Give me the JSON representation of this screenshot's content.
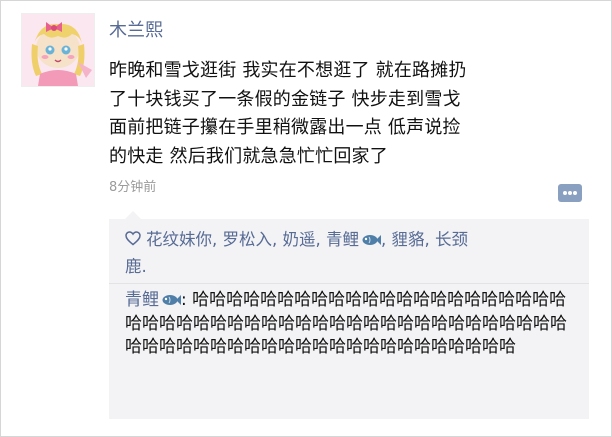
{
  "post": {
    "username": "木兰熙",
    "avatar_icon": "anime-girl-avatar",
    "lines": [
      "昨晚和雪戈逛街 我实在不想逛了 就在路摊扔",
      "了十块钱买了一条假的金链子 快步走到雪戈",
      "面前把链子攥在手里稍微露出一点 低声说捡",
      "的快走 然后我们就急急忙忙回家了"
    ],
    "timestamp": "8分钟前",
    "comment_toggle_icon": "comment-ellipsis-icon"
  },
  "likes": {
    "icon": "heart-icon",
    "names": [
      "花纹妹你",
      "罗松入",
      "奶遥",
      "青鲤",
      "貍貉",
      "长颈"
    ],
    "line2": "鹿."
  },
  "comment": {
    "author": "青鲤",
    "author_icon": "fish-icon",
    "colon": ": ",
    "text": "哈哈哈哈哈哈哈哈哈哈哈哈哈哈哈哈哈哈哈哈哈哈哈哈哈哈哈哈哈哈哈哈哈哈哈哈哈哈哈哈哈哈哈哈哈哈哈哈哈哈哈哈哈哈哈哈哈哈哈哈哈哈哈哈哈哈哈哈哈哈哈"
  },
  "colors": {
    "link": "#576b95",
    "panel_bg": "#f3f3f5",
    "time": "#9b9b9b"
  }
}
